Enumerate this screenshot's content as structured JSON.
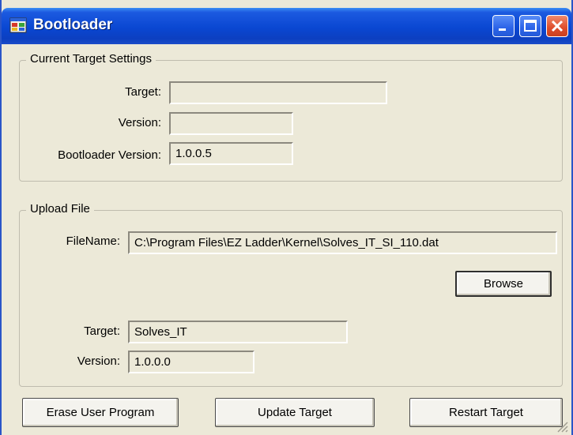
{
  "window": {
    "title": "Bootloader"
  },
  "current_target": {
    "legend": "Current Target Settings",
    "target_label": "Target:",
    "target_value": "",
    "version_label": "Version:",
    "version_value": "",
    "bootloader_version_label": "Bootloader Version:",
    "bootloader_version_value": "1.0.0.5"
  },
  "upload_file": {
    "legend": "Upload File",
    "filename_label": "FileName:",
    "filename_value": "C:\\Program Files\\EZ Ladder\\Kernel\\Solves_IT_SI_110.dat",
    "browse_label": "Browse",
    "target_label": "Target:",
    "target_value": "Solves_IT",
    "version_label": "Version:",
    "version_value": "1.0.0.0"
  },
  "actions": {
    "erase_label": "Erase User Program",
    "update_label": "Update Target",
    "restart_label": "Restart Target"
  },
  "icons": {
    "app": "bootloader-app-icon",
    "minimize": "minimize-icon",
    "maximize": "maximize-icon",
    "close": "close-icon",
    "resize": "resize-grip-icon"
  },
  "colors": {
    "titlebar": "#0a47d2",
    "window_bg": "#ece9d8",
    "close_button": "#de4c2a"
  }
}
